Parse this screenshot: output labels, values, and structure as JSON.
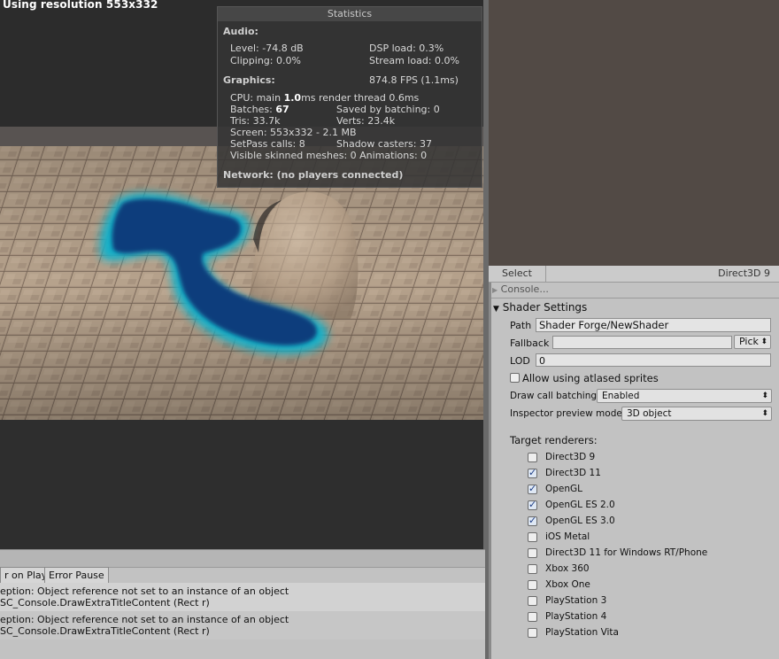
{
  "game": {
    "resolution_label": "Using resolution 553x332",
    "stats": {
      "title": "Statistics",
      "audio_header": "Audio:",
      "level": "Level: -74.8 dB",
      "dsp_load": "DSP load: 0.3%",
      "clipping": "Clipping: 0.0%",
      "stream_load": "Stream load: 0.0%",
      "graphics_header": "Graphics:",
      "fps": "874.8 FPS (1.1ms)",
      "cpu_prefix": "CPU: main ",
      "cpu_main": "1.0",
      "cpu_suffix": "ms  render thread 0.6ms",
      "batches_prefix": "Batches: ",
      "batches": "67",
      "saved_by_batching": "Saved by batching: 0",
      "tris": "Tris: 33.7k",
      "verts": "Verts: 23.4k",
      "screen": "Screen: 553x332 - 2.1 MB",
      "setpass": "SetPass calls: 8",
      "shadow_casters": "Shadow casters: 37",
      "skinned": "Visible skinned meshes: 0  Animations: 0",
      "network": "Network: (no players connected)"
    }
  },
  "console": {
    "clear_on_play": "r on Play",
    "error_pause": "Error Pause",
    "messages": [
      {
        "line1": "eption: Object reference not set to an instance of an object",
        "line2": "SC_Console.DrawExtraTitleContent (Rect r)"
      },
      {
        "line1": "eption: Object reference not set to an instance of an object",
        "line2": "SC_Console.DrawExtraTitleContent (Rect r)"
      }
    ]
  },
  "inspector": {
    "select_tab": "Select",
    "api": "Direct3D 9",
    "console_foldout": "Console...",
    "section_title": "Shader Settings",
    "path_label": "Path",
    "path_value": "Shader Forge/NewShader",
    "fallback_label": "Fallback",
    "fallback_value": "",
    "pick_label": "Pick",
    "lod_label": "LOD",
    "lod_value": "0",
    "atlased_label": "Allow using atlased sprites",
    "atlased_checked": false,
    "batching_label": "Draw call batching",
    "batching_value": "Enabled",
    "preview_mode_label": "Inspector preview mode",
    "preview_mode_value": "3D object",
    "target_label": "Target renderers:",
    "renderers": [
      {
        "name": "Direct3D 9",
        "checked": false
      },
      {
        "name": "Direct3D 11",
        "checked": true
      },
      {
        "name": "OpenGL",
        "checked": true
      },
      {
        "name": "OpenGL ES 2.0",
        "checked": true
      },
      {
        "name": "OpenGL ES 3.0",
        "checked": true
      },
      {
        "name": "iOS Metal",
        "checked": false
      },
      {
        "name": "Direct3D 11 for Windows RT/Phone",
        "checked": false
      },
      {
        "name": "Xbox 360",
        "checked": false
      },
      {
        "name": "Xbox One",
        "checked": false
      },
      {
        "name": "PlayStation 3",
        "checked": false
      },
      {
        "name": "PlayStation 4",
        "checked": false
      },
      {
        "name": "PlayStation Vita",
        "checked": false
      }
    ]
  },
  "colors": {
    "preview_bg": "#524a45",
    "inspector_bg": "#c2c2c2",
    "fluid_core": "#0a3c7c",
    "fluid_edge": "#16b0c8",
    "ground": "#a48f78"
  }
}
